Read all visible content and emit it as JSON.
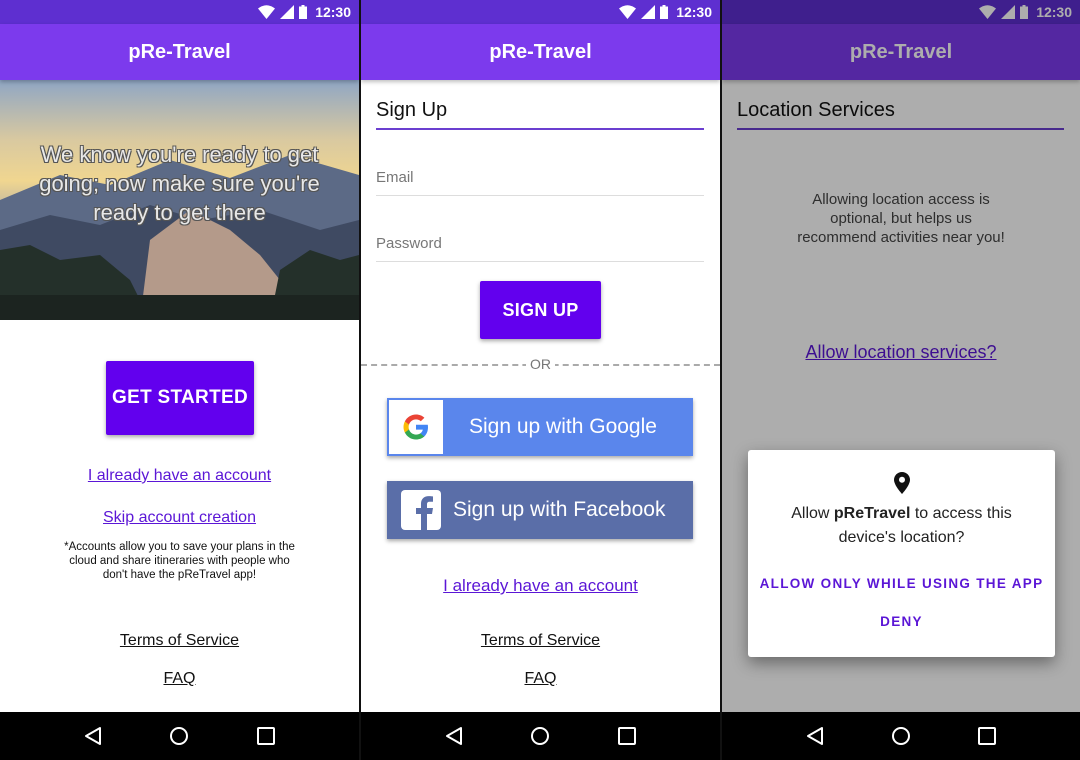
{
  "status_bar": {
    "time": "12:30"
  },
  "app": {
    "title": "pRe-Travel"
  },
  "screen1": {
    "hero_text": "We know you're ready to get going; now make sure you're ready to get there",
    "get_started": "GET STARTED",
    "have_account": "I already have an account",
    "skip_creation": "Skip account creation",
    "note": "*Accounts allow you to save your plans in the cloud and share itineraries with people who don't have the pReTravel app!",
    "terms": "Terms of Service",
    "faq": "FAQ"
  },
  "screen2": {
    "heading": "Sign Up",
    "email_placeholder": "Email",
    "password_placeholder": "Password",
    "sign_up": "SIGN UP",
    "or": "OR",
    "google": "Sign up with Google",
    "facebook": "Sign up with Facebook",
    "have_account": "I already have an account",
    "terms": "Terms of Service",
    "faq": "FAQ"
  },
  "screen3": {
    "heading": "Location Services",
    "description": "Allowing location access is optional, but helps us recommend activities near you!",
    "allow_link": "Allow location services?",
    "dialog": {
      "msg_prefix": "Allow ",
      "app_name": "pReTravel",
      "msg_suffix": " to access this device's location?",
      "allow_btn": "ALLOW ONLY WHILE USING THE APP",
      "deny_btn": "DENY"
    }
  },
  "colors": {
    "primary": "#7c3aed",
    "button": "#6200ee",
    "link": "#5b16d6",
    "status_bar": "#5e2fd0"
  }
}
